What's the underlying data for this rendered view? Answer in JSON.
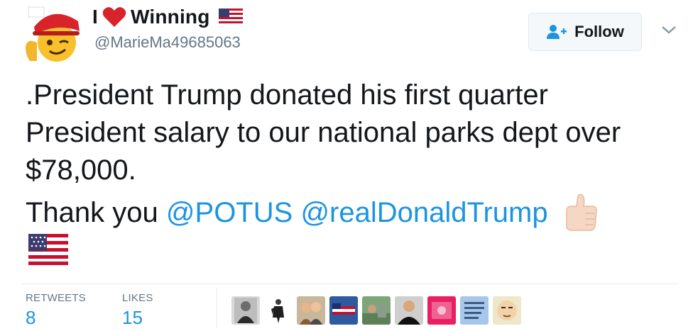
{
  "author": {
    "name_letter": "I",
    "name_word": "Winning",
    "handle": "@MarieMa49685063",
    "icons": [
      "emoji-maga-hat-wink-avatar",
      "red-heart-icon",
      "us-flag-icon"
    ]
  },
  "follow_button": {
    "label": "Follow",
    "icon": "add-user-icon"
  },
  "menu": {
    "icon": "chevron-down-icon"
  },
  "tweet": {
    "line1": ".President Trump donated his first quarter President salary to our national parks dept over $78,000.",
    "thanks": "Thank you",
    "mention1": "@POTUS",
    "mention2": "@realDonaldTrump",
    "trailing_icons": [
      "thumbs-up-icon",
      "us-flag-icon"
    ]
  },
  "stats": {
    "retweets_label": "RETWEETS",
    "retweets_value": "8",
    "likes_label": "LIKES",
    "likes_value": "15"
  },
  "likers": [
    "liker-avatar-1",
    "liker-avatar-2",
    "liker-avatar-3",
    "liker-avatar-4",
    "liker-avatar-5",
    "liker-avatar-6",
    "liker-avatar-7",
    "liker-avatar-8",
    "liker-avatar-9"
  ],
  "colors": {
    "link": "#1b95e0",
    "muted": "#657786",
    "text": "#14171a"
  }
}
